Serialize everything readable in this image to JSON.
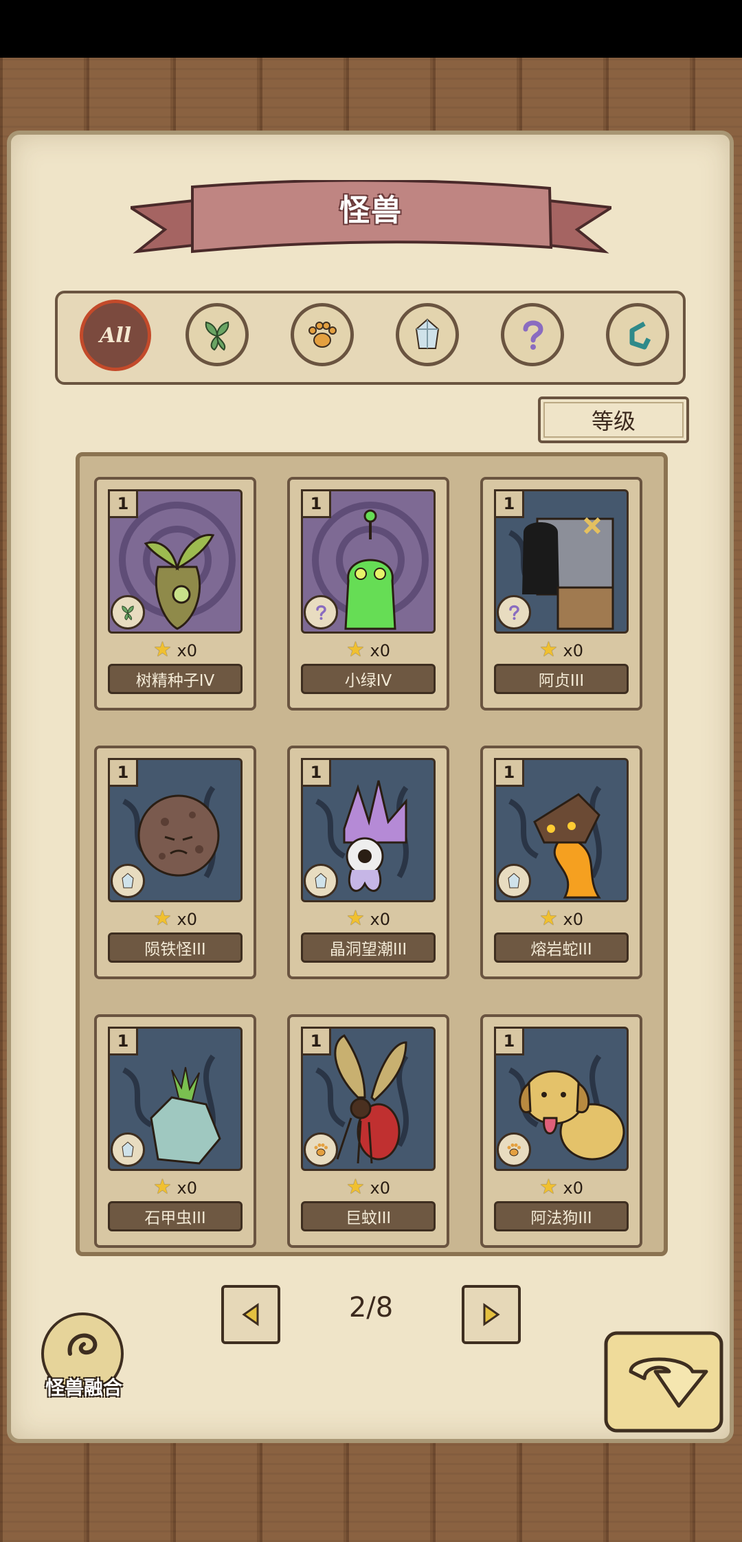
{
  "screen_title": "怪兽",
  "filters": [
    {
      "label": "All",
      "icon": "all-icon",
      "selected": true
    },
    {
      "icon": "leaf-icon"
    },
    {
      "icon": "paw-icon"
    },
    {
      "icon": "crystal-icon"
    },
    {
      "icon": "question-icon"
    },
    {
      "icon": "hook-icon"
    }
  ],
  "sort_button": "等级",
  "cards": [
    {
      "level": "1",
      "stars": "x0",
      "name": "树精种子IV",
      "element": "leaf-icon",
      "bg": "purple"
    },
    {
      "level": "1",
      "stars": "x0",
      "name": "小绿IV",
      "element": "question-icon",
      "bg": "purple"
    },
    {
      "level": "1",
      "stars": "x0",
      "name": "阿贞III",
      "element": "question-icon",
      "bg": "blue"
    },
    {
      "level": "1",
      "stars": "x0",
      "name": "陨铁怪III",
      "element": "crystal-icon",
      "bg": "blue"
    },
    {
      "level": "1",
      "stars": "x0",
      "name": "晶洞望潮III",
      "element": "crystal-icon",
      "bg": "blue"
    },
    {
      "level": "1",
      "stars": "x0",
      "name": "熔岩蛇III",
      "element": "crystal-icon",
      "bg": "blue"
    },
    {
      "level": "1",
      "stars": "x0",
      "name": "石甲虫III",
      "element": "crystal-icon",
      "bg": "blue"
    },
    {
      "level": "1",
      "stars": "x0",
      "name": "巨蚊III",
      "element": "paw-icon",
      "bg": "blue"
    },
    {
      "level": "1",
      "stars": "x0",
      "name": "阿法狗III",
      "element": "paw-icon",
      "bg": "blue"
    }
  ],
  "pagination": {
    "text": "2/8"
  },
  "fusion_label": "怪兽融合",
  "colors": {
    "parchment": "#efe4c8",
    "wood": "#8a6241",
    "ribbon": "#b87b78",
    "accent_red": "#c34a2a"
  }
}
